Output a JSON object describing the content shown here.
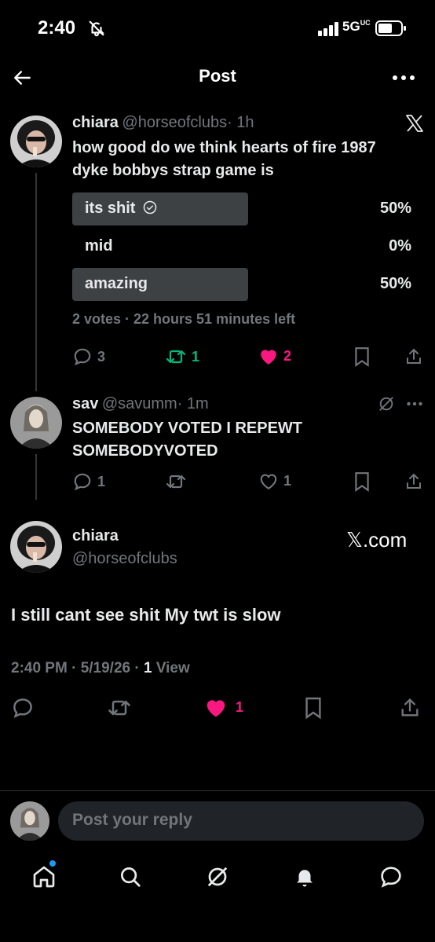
{
  "status": {
    "time": "2:40",
    "network": "5G",
    "network_sup": "UC"
  },
  "header": {
    "title": "Post"
  },
  "post": {
    "name": "chiara",
    "handle": "@horseofclubs",
    "time": "· 1h",
    "line1": "how good do we think hearts of fire 1987",
    "line2": "dyke bobbys strap game is",
    "poll": {
      "options": [
        {
          "label": "its shit",
          "pct": "50%",
          "fraction": 0.5,
          "selected": true
        },
        {
          "label": "mid",
          "pct": "0%",
          "fraction": 0.0,
          "selected": false
        },
        {
          "label": "amazing",
          "pct": "50%",
          "fraction": 0.5,
          "selected": false
        }
      ],
      "meta": "2 votes · 22 hours 51 minutes left"
    },
    "actions": {
      "replies": "3",
      "reposts": "1",
      "likes": "2"
    }
  },
  "reply": {
    "name": "sav",
    "handle": "@savumm",
    "time": "· 1m",
    "line1": "SOMEBODY VOTED I REPEWT",
    "line2": "SOMEBODYVOTED",
    "actions": {
      "replies": "1",
      "likes": "1"
    }
  },
  "main": {
    "name": "chiara",
    "handle": "@horseofclubs",
    "brand": "𝕏.com",
    "text": "I still cant see shit My twt is slow",
    "timestamp": "2:40 PM · 5/19/26 · ",
    "views_count": "1",
    "views_label": " View",
    "actions": {
      "likes": "1"
    }
  },
  "composer": {
    "placeholder": "Post your reply"
  },
  "colors": {
    "like": "#f91880",
    "repost": "#00ba7c",
    "accent": "#1d9bf0"
  }
}
